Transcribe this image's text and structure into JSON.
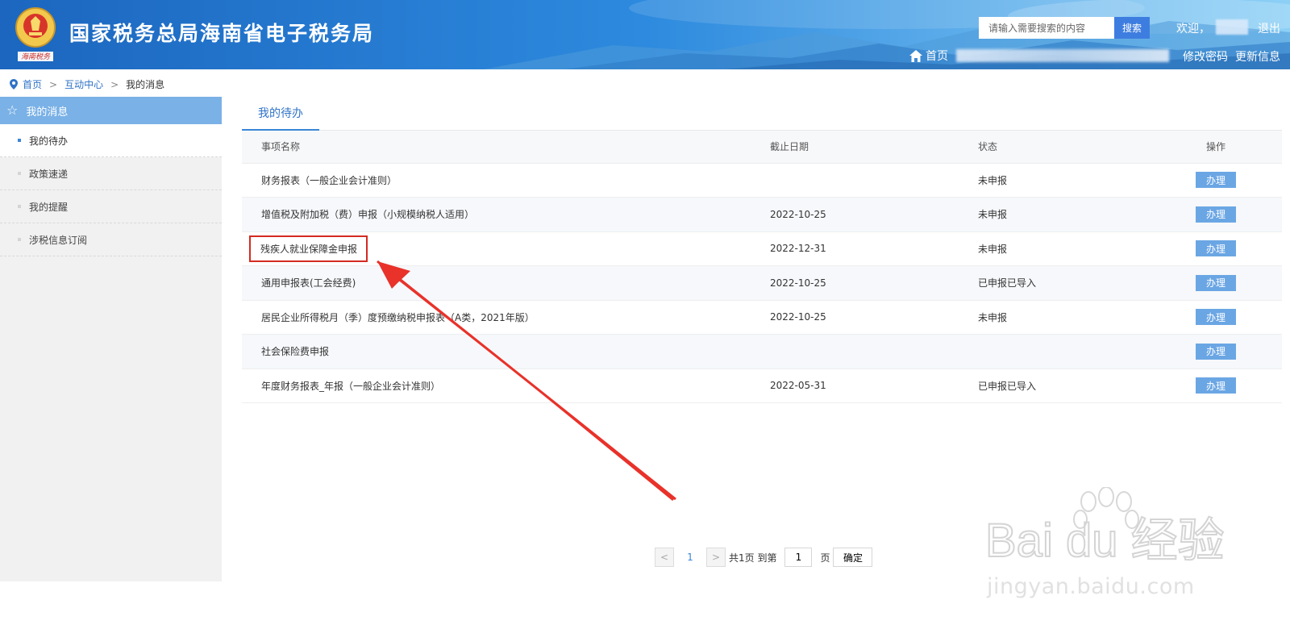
{
  "header": {
    "site_title": "国家税务总局海南省电子税务局",
    "emblem_caption": "海南税务",
    "search": {
      "placeholder": "请输入需要搜索的内容",
      "button_label": "搜索"
    },
    "welcome_text": "欢迎，",
    "logout_label": "退出",
    "home_label": "首页",
    "change_password_label": "修改密码",
    "update_info_label": "更新信息",
    "home_icon": "home-icon"
  },
  "breadcrumb": {
    "items": [
      "首页",
      "互动中心",
      "我的消息"
    ],
    "separator": ">",
    "icon": "location-pin-icon"
  },
  "sidebar": {
    "title": "我的消息",
    "title_icon": "star-icon",
    "items": [
      {
        "label": "我的待办",
        "active": true
      },
      {
        "label": "政策速递",
        "active": false
      },
      {
        "label": "我的提醒",
        "active": false
      },
      {
        "label": "涉税信息订阅",
        "active": false
      }
    ]
  },
  "main": {
    "tab_label": "我的待办",
    "table": {
      "columns": [
        "事项名称",
        "截止日期",
        "状态",
        "操作"
      ],
      "rows": [
        {
          "name": "财务报表（一般企业会计准则）",
          "date": "",
          "status": "未申报",
          "status_type": "pending",
          "action": "办理"
        },
        {
          "name": "增值税及附加税（费）申报（小规模纳税人适用）",
          "date": "2022-10-25",
          "status": "未申报",
          "status_type": "pending",
          "action": "办理"
        },
        {
          "name": "残疾人就业保障金申报",
          "date": "2022-12-31",
          "status": "未申报",
          "status_type": "pending",
          "action": "办理",
          "highlighted": true
        },
        {
          "name": "通用申报表(工会经费)",
          "date": "2022-10-25",
          "status": "已申报已导入",
          "status_type": "done",
          "action": "办理"
        },
        {
          "name": "居民企业所得税月（季）度预缴纳税申报表（A类，2021年版）",
          "date": "2022-10-25",
          "status": "未申报",
          "status_type": "pending",
          "action": "办理"
        },
        {
          "name": "社会保险费申报",
          "date": "",
          "status": "",
          "status_type": "",
          "action": "办理"
        },
        {
          "name": "年度财务报表_年报（一般企业会计准则）",
          "date": "2022-05-31",
          "status": "已申报已导入",
          "status_type": "done",
          "action": "办理"
        }
      ]
    },
    "pagination": {
      "prev_label": "<",
      "current_page": "1",
      "next_label": ">",
      "total_text": "共1页 到第",
      "goto_value": "1",
      "page_unit": "页",
      "confirm_label": "确定"
    }
  },
  "colors": {
    "header_blue": "#2a86da",
    "accent": "#3a86d6",
    "status_pending": "#f0883a",
    "status_done": "#4aab5c",
    "annotation_red": "#e8322a"
  },
  "watermark": {
    "line1": "Bai du 经验",
    "line2": "jingyan.baidu.com"
  }
}
